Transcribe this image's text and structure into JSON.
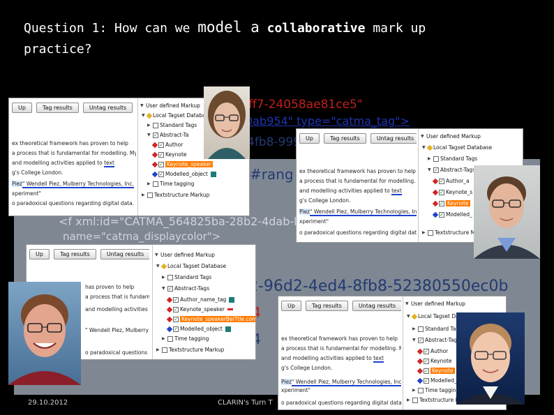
{
  "title": {
    "line1_a": "Question 1: How can we ",
    "line1_b": "model a",
    "line1_c": " collaborative",
    "line1_d": " mark up",
    "line2": "practice?"
  },
  "xml_fragments": {
    "frag_ae": "ff7-24058ae81ce5\"",
    "frag_tag": "0ab954\" type=\"catma_tag\">",
    "frag_fb8": "4fb8-999",
    "frag_rang": "#rang",
    "frag_xmlid": "<f xml:id=\"CATMA_564825ba-28b2-4dab-b2",
    "frag_name": "name=\"catma_displaycolor\">",
    "frag_96d2": "2-96d2-4ed4-8fb8-52380550ec0b",
    "frag_4a": "-4",
    "frag_4b": "-4"
  },
  "buttons": {
    "up": "Up",
    "tag_results": "Tag results",
    "untag_results": "Untag results"
  },
  "doc_text": {
    "t1": "ex theoretical framework has proven to help",
    "t2": "a process that is fundamental for modelling. My",
    "t3": "and modelling activities applied to ",
    "t3_word": "text",
    "t4": "g's College London.",
    "t5_word": "Piez",
    "t5": "\" Wendell Piez, Mulberry Technologies, Inc.",
    "t6": "xperiment\"",
    "t7": "o paradoxical questions regarding digital data.",
    "t8": " has proven to help"
  },
  "tree": {
    "user_defined_markup": "User defined Markup",
    "local_tagset_database": "Local Tagset Database",
    "standard_tags": "Standard Tags",
    "abstract_tags": "Abstract-Tags",
    "author_name_tag": "Author_name_tag",
    "keynote_speaker": "Keynote_speaker",
    "keynote_speaker_selected": "Keynote_speakerBeiTtle.com",
    "modelled_object": "Modelled_object",
    "time_tagging": "Time tagging",
    "textstructure_markup": "Textstructure Markup",
    "abstract_trunc": "Abstract-Ta",
    "author_trunc": "Author",
    "keynote_trunc": "Keynote",
    "modelled_trunc": "Modelled_obje",
    "textstructure_trunc": "Textstructure Mark",
    "author_a": "Author_a",
    "keynote_s": "Keynote_s",
    "modelled_": "Modelled_",
    "time_taggin": "Time taggin"
  },
  "footer": {
    "date": "29.10.2012",
    "event": "CLARIN's Turn T"
  },
  "colors": {
    "background": "#000000",
    "slate": "#7f8892",
    "xml_red": "#c0201c",
    "xml_blue": "#1f35b5",
    "selection_orange": "#ff7b00",
    "tag_teal": "#1c7d78"
  }
}
